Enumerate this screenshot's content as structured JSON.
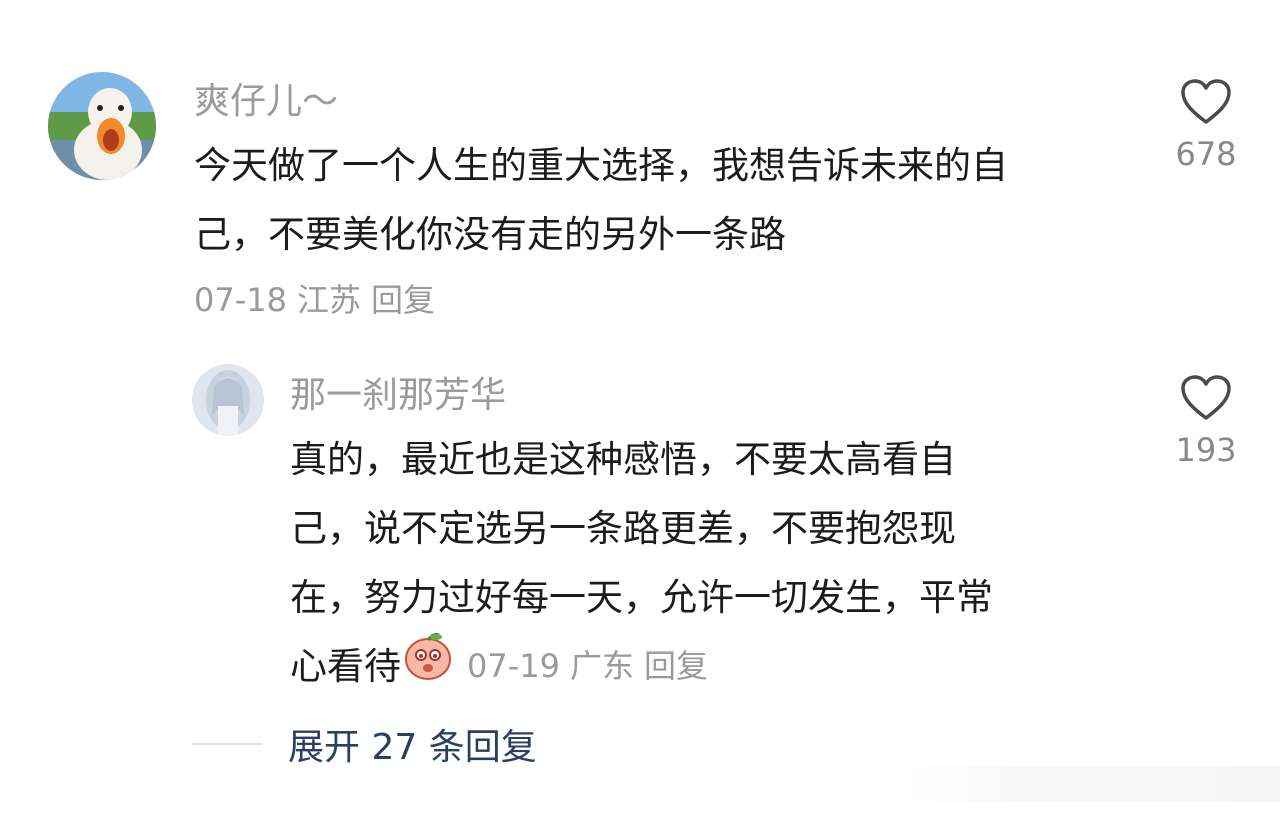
{
  "comment": {
    "username": "爽仔儿～",
    "lines": [
      "今天做了一个人生的重大选择，我想告诉未来的自",
      "己，不要美化你没有走的另外一条路"
    ],
    "date": "07-18",
    "location": "江苏",
    "reply_label": "回复",
    "likes": "678"
  },
  "reply": {
    "username": "那一刹那芳华",
    "lines": [
      "真的，最近也是这种感悟，不要太高看自",
      "己，说不定选另一条路更差，不要抱怨现",
      "在，努力过好每一天，允许一切发生，平常",
      "心看待"
    ],
    "date": "07-19",
    "location": "广东",
    "reply_label": "回复",
    "likes": "193"
  },
  "expand_label": "展开 27 条回复",
  "icons": {
    "like": "heart-outline-icon",
    "emoji": "peach-emoji-icon",
    "avatar_main": "duck-avatar",
    "avatar_reply": "girl-avatar"
  },
  "colors": {
    "username": "#9b9b9b",
    "text": "#1c1c1c",
    "meta": "#9a9a9a",
    "expand": "#2a3f66"
  }
}
